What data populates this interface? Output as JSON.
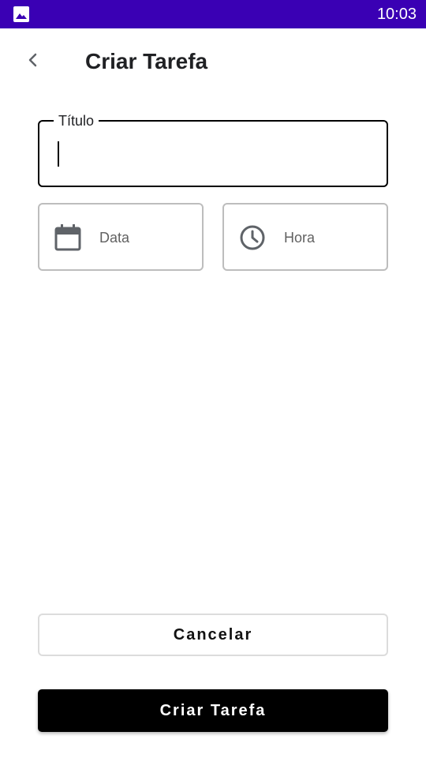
{
  "status_bar": {
    "time": "10:03",
    "background_color": "#3a00b4",
    "icons": [
      "image-icon"
    ]
  },
  "app_bar": {
    "title": "Criar Tarefa",
    "back_icon": "chevron-left-icon"
  },
  "form": {
    "title_field": {
      "label": "Título",
      "value": "",
      "placeholder": ""
    },
    "date_picker": {
      "label": "Data",
      "icon": "calendar-icon"
    },
    "time_picker": {
      "label": "Hora",
      "icon": "clock-icon"
    }
  },
  "actions": {
    "cancel_label": "Cancelar",
    "create_label": "Criar Tarefa"
  }
}
